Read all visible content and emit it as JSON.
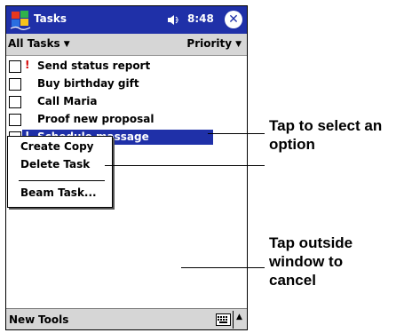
{
  "title_bar": {
    "app_title": "Tasks",
    "clock": "8:48"
  },
  "filter_bar": {
    "filter_label": "All Tasks",
    "sort_label": "Priority"
  },
  "tasks": [
    {
      "name": "Send status report",
      "priority": "!",
      "selected": false
    },
    {
      "name": "Buy birthday gift",
      "priority": "",
      "selected": false
    },
    {
      "name": "Call Maria",
      "priority": "",
      "selected": false
    },
    {
      "name": "Proof new proposal",
      "priority": "",
      "selected": false
    },
    {
      "name": "Schedule massage",
      "priority": "!",
      "selected": true
    }
  ],
  "context_menu": {
    "items": [
      "Create Copy",
      "Delete Task",
      "Beam Task..."
    ]
  },
  "bottom_bar": {
    "menus": [
      "New",
      "Tools"
    ]
  },
  "annotations": {
    "tap_select": [
      "Tap to select an",
      "option"
    ],
    "tap_outside": [
      "Tap outside",
      "window to",
      "cancel"
    ]
  },
  "colors": {
    "title_bar": "#1f30a8",
    "selection": "#1f30a8",
    "bars": "#d6d6d6",
    "priority": "#d40000"
  }
}
